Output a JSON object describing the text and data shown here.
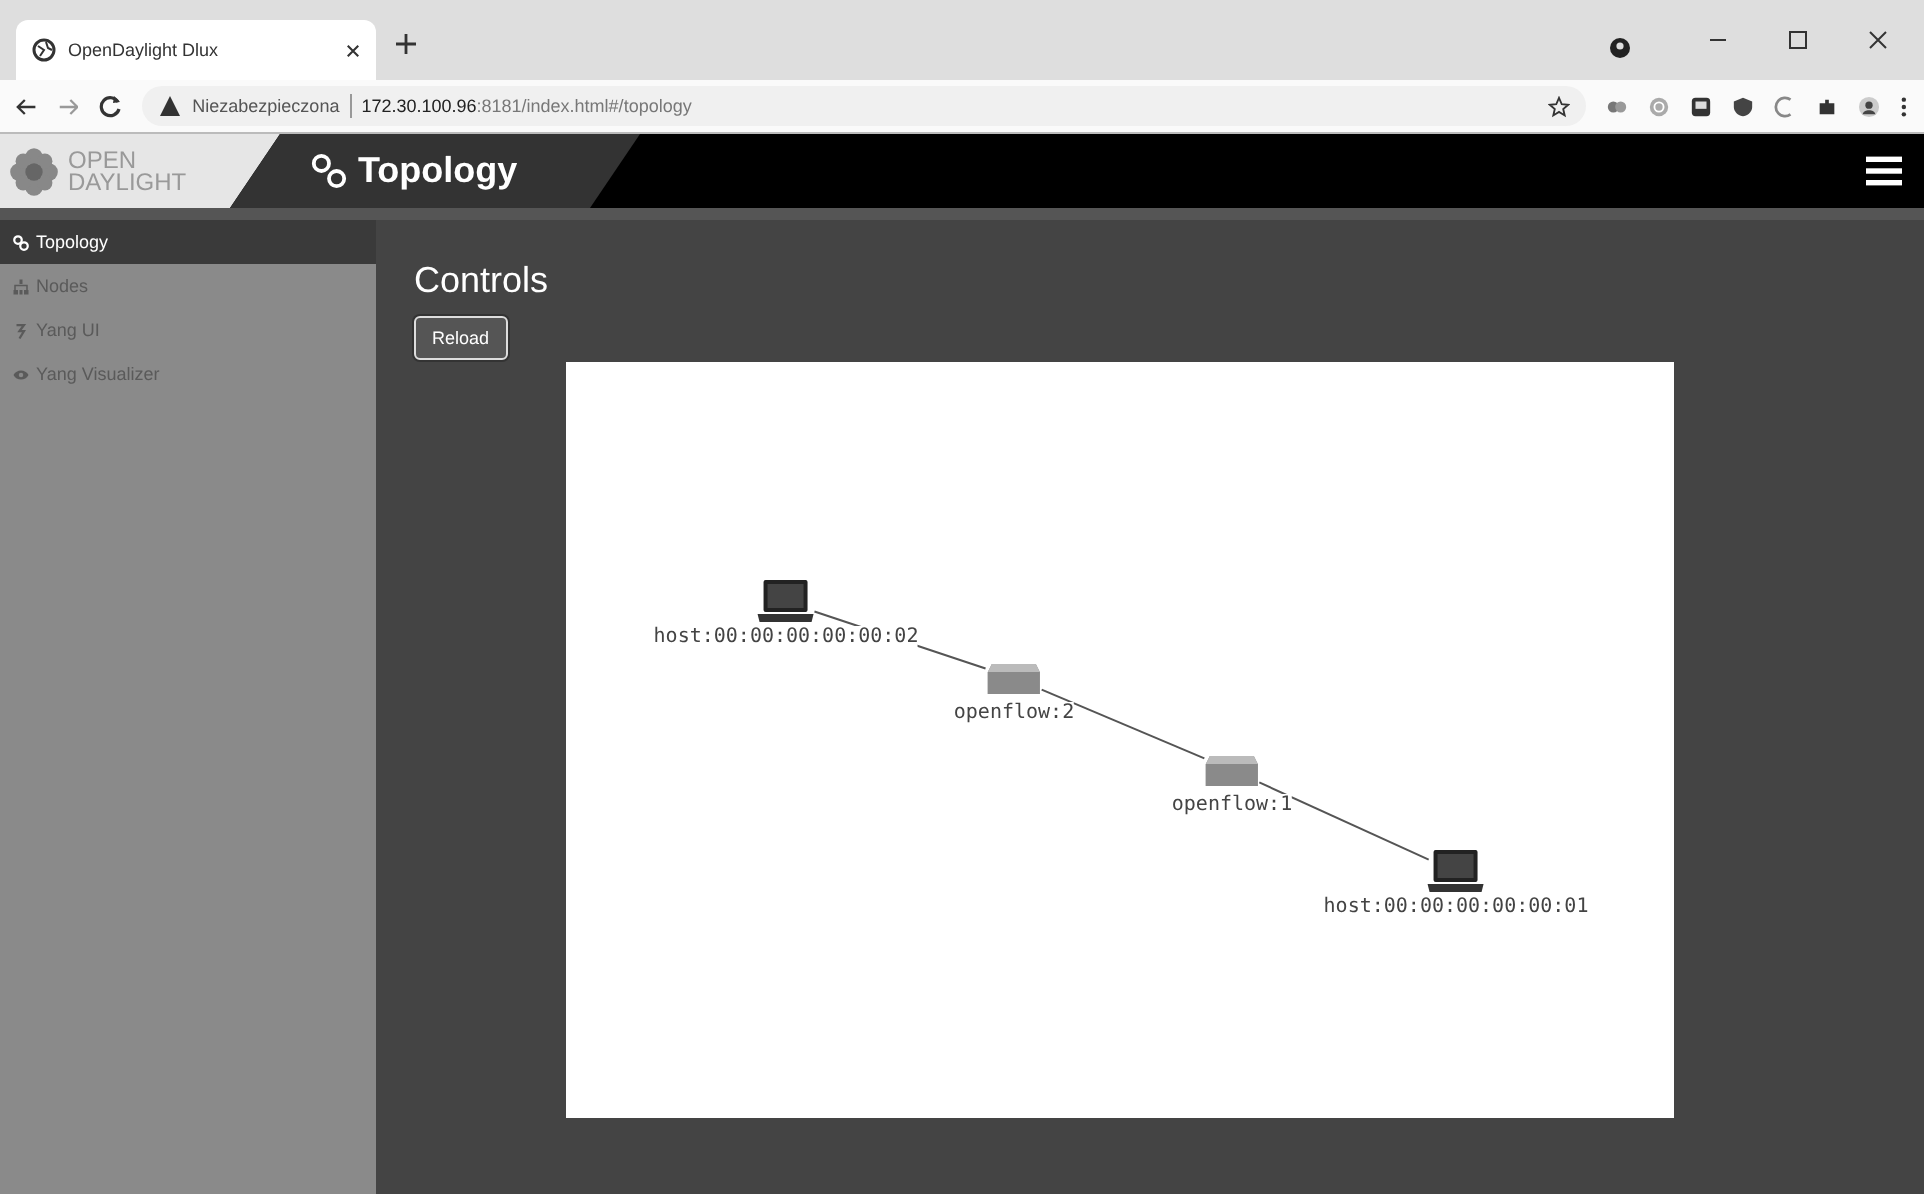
{
  "browser": {
    "tab_title": "OpenDaylight Dlux",
    "security": "Niezabezpieczona",
    "url": "**172.30.100.96**:8181/index.html#/topology"
  },
  "header": {
    "logo_lines": [
      "OPEN",
      "DAYLIGHT"
    ],
    "title": "Topology"
  },
  "sidebar": {
    "items": [
      {
        "label": "Topology",
        "selected": true
      },
      {
        "label": "Nodes",
        "selected": false
      },
      {
        "label": "Yang UI",
        "selected": false
      },
      {
        "label": "Yang Visualizer",
        "selected": false
      }
    ]
  },
  "main": {
    "heading": "Controls",
    "buttons": [
      "Reload"
    ]
  },
  "topology": {
    "nodes": [
      {
        "kind": "host",
        "label": "host:00:00:00:00:00:02"
      },
      {
        "kind": "switch",
        "label": "openflow:2"
      },
      {
        "kind": "switch",
        "label": "openflow:1"
      },
      {
        "kind": "host",
        "label": "host:00:00:00:00:00:01"
      }
    ]
  }
}
